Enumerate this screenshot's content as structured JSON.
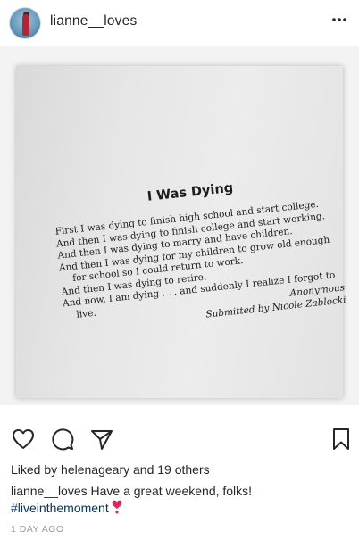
{
  "header": {
    "username": "lianne__loves",
    "more_icon": "more-horizontal-icon"
  },
  "post_image": {
    "title": "I Was Dying",
    "lines": [
      "First I was dying to finish high school and start college.",
      "And then I was dying to finish college and start working.",
      "And then I was dying to marry and have children.",
      "And then I was dying for my children to grow old enough",
      "for school so I could return to work.",
      "And then I was dying to retire.",
      "And now, I am dying . . . and suddenly I realize I forgot to",
      "live."
    ],
    "author": "Anonymous",
    "submitted_by": "Submitted by Nicole Zablocki"
  },
  "actions": {
    "like_icon": "heart-icon",
    "comment_icon": "comment-icon",
    "share_icon": "send-icon",
    "save_icon": "bookmark-icon"
  },
  "likes": {
    "prefix": "Liked by ",
    "user": "helenageary",
    "middle": " and ",
    "others": "19 others"
  },
  "caption": {
    "user": "lianne__loves",
    "text": " Have a great weekend, folks!",
    "hashtag": "#liveinthemoment",
    "emoji_icon": "heart-exclamation-icon",
    "emoji_color": "#e0245e"
  },
  "timestamp": "1 DAY AGO",
  "colors": {
    "text": "#262626",
    "hashtag": "#003569",
    "meta": "#999999"
  }
}
